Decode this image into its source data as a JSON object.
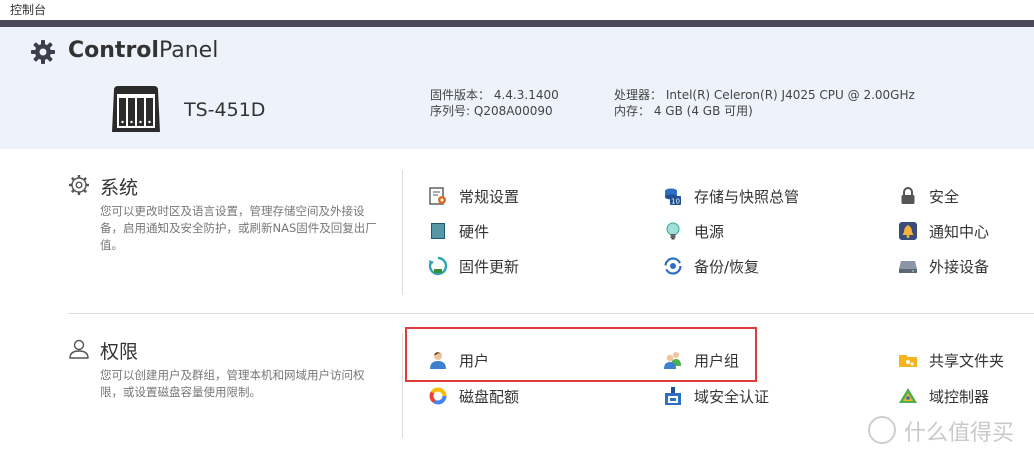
{
  "window": {
    "title": "控制台"
  },
  "header": {
    "brand_bold": "Control",
    "brand_light": "Panel",
    "model": "TS-451D",
    "firmware_label": "固件版本：",
    "firmware_value": "4.4.3.1400",
    "serial_label": "序列号:",
    "serial_value": "Q208A00090",
    "cpu_label": "处理器：",
    "cpu_value": "Intel(R) Celeron(R) J4025 CPU @ 2.00GHz",
    "memory_label": "内存：",
    "memory_value": "4 GB (4 GB 可用)"
  },
  "system": {
    "title": "系统",
    "description": "您可以更改时区及语言设置，管理存储空间及外接设备，启用通知及安全防护，或刷新NAS固件及回复出厂值。",
    "items": [
      {
        "label": "常规设置",
        "icon": "settings-doc-icon"
      },
      {
        "label": "存储与快照总管",
        "icon": "storage-icon"
      },
      {
        "label": "安全",
        "icon": "lock-icon"
      },
      {
        "label": "硬件",
        "icon": "hardware-icon"
      },
      {
        "label": "电源",
        "icon": "power-bulb-icon"
      },
      {
        "label": "通知中心",
        "icon": "notification-icon"
      },
      {
        "label": "固件更新",
        "icon": "firmware-update-icon"
      },
      {
        "label": "备份/恢复",
        "icon": "backup-restore-icon"
      },
      {
        "label": "外接设备",
        "icon": "external-device-icon"
      }
    ]
  },
  "privilege": {
    "title": "权限",
    "description": "您可以创建用户及群组，管理本机和网域用户访问权限，或设置磁盘容量使用限制。",
    "items": [
      {
        "label": "用户",
        "icon": "user-icon"
      },
      {
        "label": "用户组",
        "icon": "user-group-icon"
      },
      {
        "label": "共享文件夹",
        "icon": "shared-folder-icon"
      },
      {
        "label": "磁盘配额",
        "icon": "disk-quota-icon"
      },
      {
        "label": "域安全认证",
        "icon": "domain-security-icon"
      },
      {
        "label": "域控制器",
        "icon": "domain-controller-icon"
      }
    ]
  },
  "watermark": {
    "text": "什么值得买"
  }
}
